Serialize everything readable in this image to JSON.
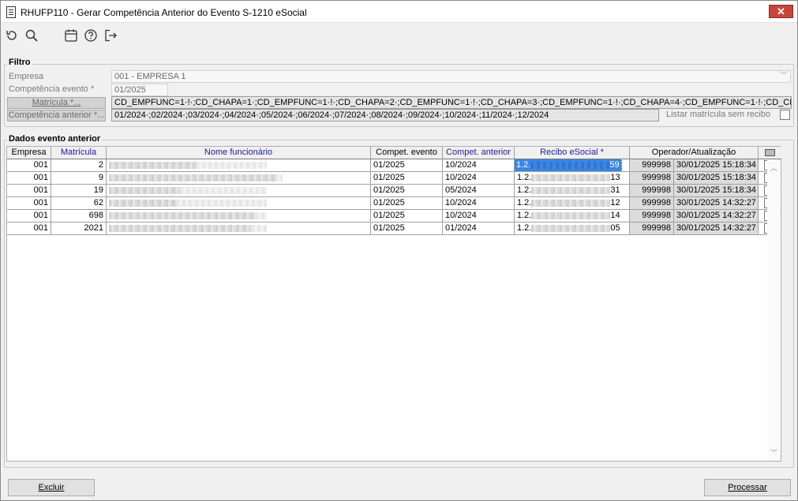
{
  "window": {
    "title": "RHUFP110 - Gerar Competência Anterior do Evento S-1210 eSocial",
    "close_glyph": "✕"
  },
  "toolbar": {
    "icons": [
      "refresh-icon",
      "search-icon",
      "calendar-icon",
      "help-icon",
      "exit-icon"
    ]
  },
  "filter": {
    "legend": "Filtro",
    "empresa_label": "Empresa",
    "empresa_value": "001 - EMPRESA 1",
    "competencia_label": "Competência evento *",
    "competencia_value": "01/2025",
    "matricula_button": "Matrícula *...",
    "matricula_value": "CD_EMPFUNC=1·!·;CD_CHAPA=1·;CD_EMPFUNC=1·!·;CD_CHAPA=2·;CD_EMPFUNC=1·!·;CD_CHAPA=3·;CD_EMPFUNC=1·!·;CD_CHAPA=4·;CD_EMPFUNC=1·!·;CD_CHAPA=5·;CD_E",
    "competencia_anterior_button": "Competência anterior *...",
    "competencia_anterior_value": "01/2024·;02/2024·;03/2024·;04/2024·;05/2024·;06/2024·;07/2024·;08/2024·;09/2024·;10/2024·;11/2024·;12/2024",
    "listar_label": "Listar matrícula sem recibo"
  },
  "grid": {
    "legend": "Dados evento anterior",
    "headers": {
      "empresa": "Empresa",
      "matricula": "Matrícula",
      "nome": "Nome funcionário",
      "compet_evento": "Compet. evento",
      "compet_anterior": "Compet. anterior",
      "recibo": "Recibo eSocial *",
      "operador": "Operador/Atualização"
    },
    "rows": [
      {
        "empresa": "001",
        "matricula": "2",
        "compet_evento": "01/2025",
        "compet_anterior": "10/2024",
        "recibo_prefix": "1.2.",
        "recibo_suffix": "59",
        "operador": "999998",
        "atualizacao": "30/01/2025 15:18:34"
      },
      {
        "empresa": "001",
        "matricula": "9",
        "compet_evento": "01/2025",
        "compet_anterior": "10/2024",
        "recibo_prefix": "1.2.",
        "recibo_suffix": "13",
        "operador": "999998",
        "atualizacao": "30/01/2025 15:18:34"
      },
      {
        "empresa": "001",
        "matricula": "19",
        "compet_evento": "01/2025",
        "compet_anterior": "05/2024",
        "recibo_prefix": "1.2.",
        "recibo_suffix": "31",
        "operador": "999998",
        "atualizacao": "30/01/2025 15:18:34"
      },
      {
        "empresa": "001",
        "matricula": "62",
        "compet_evento": "01/2025",
        "compet_anterior": "10/2024",
        "recibo_prefix": "1.2.",
        "recibo_suffix": "12",
        "operador": "999998",
        "atualizacao": "30/01/2025 14:32:27"
      },
      {
        "empresa": "001",
        "matricula": "698",
        "compet_evento": "01/2025",
        "compet_anterior": "10/2024",
        "recibo_prefix": "1.2.",
        "recibo_suffix": "14",
        "operador": "999998",
        "atualizacao": "30/01/2025 14:32:27"
      },
      {
        "empresa": "001",
        "matricula": "2021",
        "compet_evento": "01/2025",
        "compet_anterior": "01/2024",
        "recibo_prefix": "1.2.",
        "recibo_suffix": "05",
        "operador": "999998",
        "atualizacao": "30/01/2025 14:32:27"
      }
    ]
  },
  "footer": {
    "excluir": "Excluir",
    "processar": "Processar"
  }
}
